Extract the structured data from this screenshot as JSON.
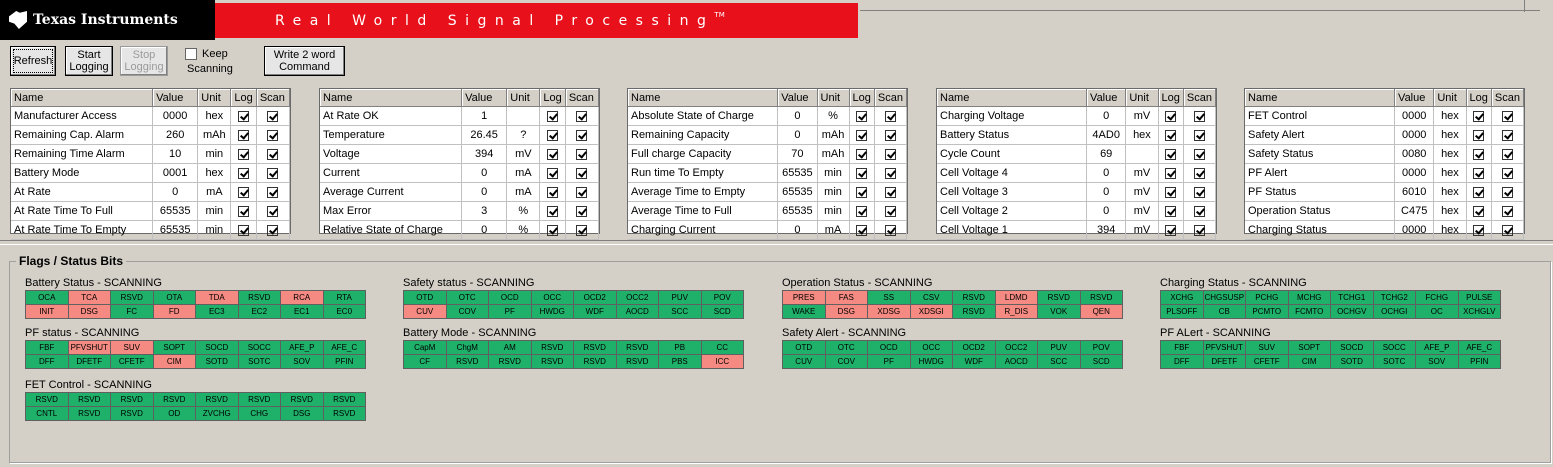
{
  "header": {
    "company": "Texas Instruments",
    "banner": "Real World Signal Processing",
    "tm": "TM"
  },
  "toolbar": {
    "refresh": "Refresh",
    "start_logging": [
      "Start",
      "Logging"
    ],
    "stop_logging": [
      "Stop",
      "Logging"
    ],
    "keep_scanning": [
      "Keep",
      "Scanning"
    ],
    "write_command": [
      "Write 2 word",
      "Command"
    ]
  },
  "table_headers": [
    "Name",
    "Value",
    "Unit",
    "Log",
    "Scan"
  ],
  "panels": [
    {
      "rows": [
        [
          "Manufacturer Access",
          "0000",
          "hex"
        ],
        [
          "Remaining Cap. Alarm",
          "260",
          "mAh"
        ],
        [
          "Remaining Time Alarm",
          "10",
          "min"
        ],
        [
          "Battery Mode",
          "0001",
          "hex"
        ],
        [
          "At Rate",
          "0",
          "mA"
        ],
        [
          "At Rate Time To Full",
          "65535",
          "min"
        ],
        [
          "At Rate Time To Empty",
          "65535",
          "min"
        ]
      ]
    },
    {
      "rows": [
        [
          "At Rate OK",
          "1",
          ""
        ],
        [
          "Temperature",
          "26.45",
          "?"
        ],
        [
          "Voltage",
          "394",
          "mV"
        ],
        [
          "Current",
          "0",
          "mA"
        ],
        [
          "Average Current",
          "0",
          "mA"
        ],
        [
          "Max Error",
          "3",
          "%"
        ],
        [
          "Relative State of Charge",
          "0",
          "%"
        ]
      ]
    },
    {
      "rows": [
        [
          "Absolute State of Charge",
          "0",
          "%"
        ],
        [
          "Remaining Capacity",
          "0",
          "mAh"
        ],
        [
          "Full charge Capacity",
          "70",
          "mAh"
        ],
        [
          "Run time To Empty",
          "65535",
          "min"
        ],
        [
          "Average Time to Empty",
          "65535",
          "min"
        ],
        [
          "Average Time to Full",
          "65535",
          "min"
        ],
        [
          "Charging Current",
          "0",
          "mA"
        ]
      ]
    },
    {
      "rows": [
        [
          "Charging Voltage",
          "0",
          "mV"
        ],
        [
          "Battery Status",
          "4AD0",
          "hex"
        ],
        [
          "Cycle Count",
          "69",
          ""
        ],
        [
          "Cell Voltage 4",
          "0",
          "mV"
        ],
        [
          "Cell Voltage 3",
          "0",
          "mV"
        ],
        [
          "Cell Voltage 2",
          "0",
          "mV"
        ],
        [
          "Cell Voltage 1",
          "394",
          "mV"
        ]
      ]
    },
    {
      "rows": [
        [
          "FET Control",
          "0000",
          "hex"
        ],
        [
          "Safety Alert",
          "0000",
          "hex"
        ],
        [
          "Safety Status",
          "0080",
          "hex"
        ],
        [
          "PF Alert",
          "0000",
          "hex"
        ],
        [
          "PF Status",
          "6010",
          "hex"
        ],
        [
          "Operation Status",
          "C475",
          "hex"
        ],
        [
          "Charging Status",
          "0000",
          "hex"
        ]
      ]
    }
  ],
  "flags_title": "Flags / Status Bits",
  "flag_groups": [
    {
      "title": "Battery Status - SCANNING",
      "bits": [
        "OCA",
        "TCA",
        "RSVD",
        "OTA",
        "TDA",
        "RSVD",
        "RCA",
        "RTA",
        "INIT",
        "DSG",
        "FC",
        "FD",
        "EC3",
        "EC2",
        "EC1",
        "EC0"
      ],
      "on": [
        1,
        4,
        6,
        8,
        9,
        11
      ]
    },
    {
      "title": "Safety status - SCANNING",
      "bits": [
        "OTD",
        "OTC",
        "OCD",
        "OCC",
        "OCD2",
        "OCC2",
        "PUV",
        "POV",
        "CUV",
        "COV",
        "PF",
        "HWDG",
        "WDF",
        "AOCD",
        "SCC",
        "SCD"
      ],
      "on": [
        8
      ]
    },
    {
      "title": "Operation Status - SCANNING",
      "bits": [
        "PRES",
        "FAS",
        "SS",
        "CSV",
        "RSVD",
        "LDMD",
        "RSVD",
        "RSVD",
        "WAKE",
        "DSG",
        "XDSG",
        "XDSGI",
        "RSVD",
        "R_DIS",
        "VOK",
        "QEN"
      ],
      "on": [
        0,
        1,
        5,
        9,
        10,
        11,
        13,
        15
      ]
    },
    {
      "title": "Charging Status - SCANNING",
      "bits": [
        "XCHG",
        "CHGSUSP",
        "PCHG",
        "MCHG",
        "TCHG1",
        "TCHG2",
        "FCHG",
        "PULSE",
        "PLSOFF",
        "CB",
        "PCMTO",
        "FCMTO",
        "OCHGV",
        "OCHGI",
        "OC",
        "XCHGLV"
      ],
      "on": []
    },
    {
      "title": "PF status - SCANNING",
      "bits": [
        "FBF",
        "PFVSHUT",
        "SUV",
        "SOPT",
        "SOCD",
        "SOCC",
        "AFE_P",
        "AFE_C",
        "DFF",
        "DFETF",
        "CFETF",
        "CIM",
        "SOTD",
        "SOTC",
        "SOV",
        "PFIN"
      ],
      "on": [
        1,
        2,
        11
      ]
    },
    {
      "title": "Battery Mode - SCANNING",
      "bits": [
        "CapM",
        "ChgM",
        "AM",
        "RSVD",
        "RSVD",
        "RSVD",
        "PB",
        "CC",
        "CF",
        "RSVD",
        "RSVD",
        "RSVD",
        "RSVD",
        "RSVD",
        "PBS",
        "ICC"
      ],
      "on": [
        15
      ]
    },
    {
      "title": "Safety Alert - SCANNING",
      "bits": [
        "OTD",
        "OTC",
        "OCD",
        "OCC",
        "OCD2",
        "OCC2",
        "PUV",
        "POV",
        "CUV",
        "COV",
        "PF",
        "HWDG",
        "WDF",
        "AOCD",
        "SCC",
        "SCD"
      ],
      "on": []
    },
    {
      "title": "PF ALert - SCANNING",
      "bits": [
        "FBF",
        "PFVSHUT",
        "SUV",
        "SOPT",
        "SOCD",
        "SOCC",
        "AFE_P",
        "AFE_C",
        "DFF",
        "DFETF",
        "CFETF",
        "CIM",
        "SOTD",
        "SOTC",
        "SOV",
        "PFIN"
      ],
      "on": []
    },
    {
      "title": "FET Control - SCANNING",
      "bits": [
        "RSVD",
        "RSVD",
        "RSVD",
        "RSVD",
        "RSVD",
        "RSVD",
        "RSVD",
        "RSVD",
        "CNTL",
        "RSVD",
        "RSVD",
        "OD",
        "ZVCHG",
        "CHG",
        "DSG",
        "RSVD"
      ],
      "on": []
    }
  ],
  "colors": {
    "bit_off": "#1fb16a",
    "bit_on": "#f58a82",
    "banner": "#e8101a"
  }
}
